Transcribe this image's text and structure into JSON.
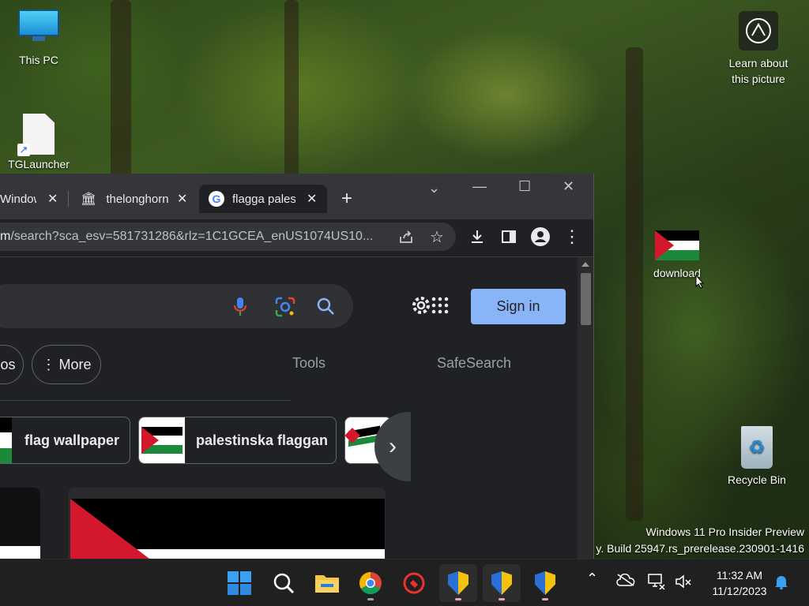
{
  "desktop": {
    "this_pc_label": "This PC",
    "tglauncher_label": "TGLauncher",
    "learn_label_1": "Learn about",
    "learn_label_2": "this picture",
    "download_label": "download",
    "recycle_bin_label": "Recycle Bin",
    "watermark_line1": "Windows 11 Pro Insider Preview",
    "watermark_line2": "y. Build 25947.rs_prerelease.230901-1416"
  },
  "browser": {
    "tabs": [
      {
        "title": "Window"
      },
      {
        "title": "thelonghorn"
      },
      {
        "title": "flagga pales",
        "active": true
      }
    ],
    "new_tab": "+",
    "url_domain": "m",
    "url_path": "/search?sca_esv=581731286&rlz=1C1GCEA_enUS1074US10..."
  },
  "google": {
    "sign_in": "Sign in",
    "chips": {
      "partial": "os",
      "more": "More",
      "tools": "Tools",
      "safesearch": "SafeSearch"
    },
    "suggestions": [
      {
        "label": "flag wallpaper"
      },
      {
        "label": "palestinska flaggan"
      }
    ]
  },
  "taskbar": {
    "time": "11:32 AM",
    "date": "11/12/2023"
  },
  "colors": {
    "accent": "#8ab4f8",
    "flag_red": "#d3172d",
    "flag_green": "#1a8a3a"
  }
}
